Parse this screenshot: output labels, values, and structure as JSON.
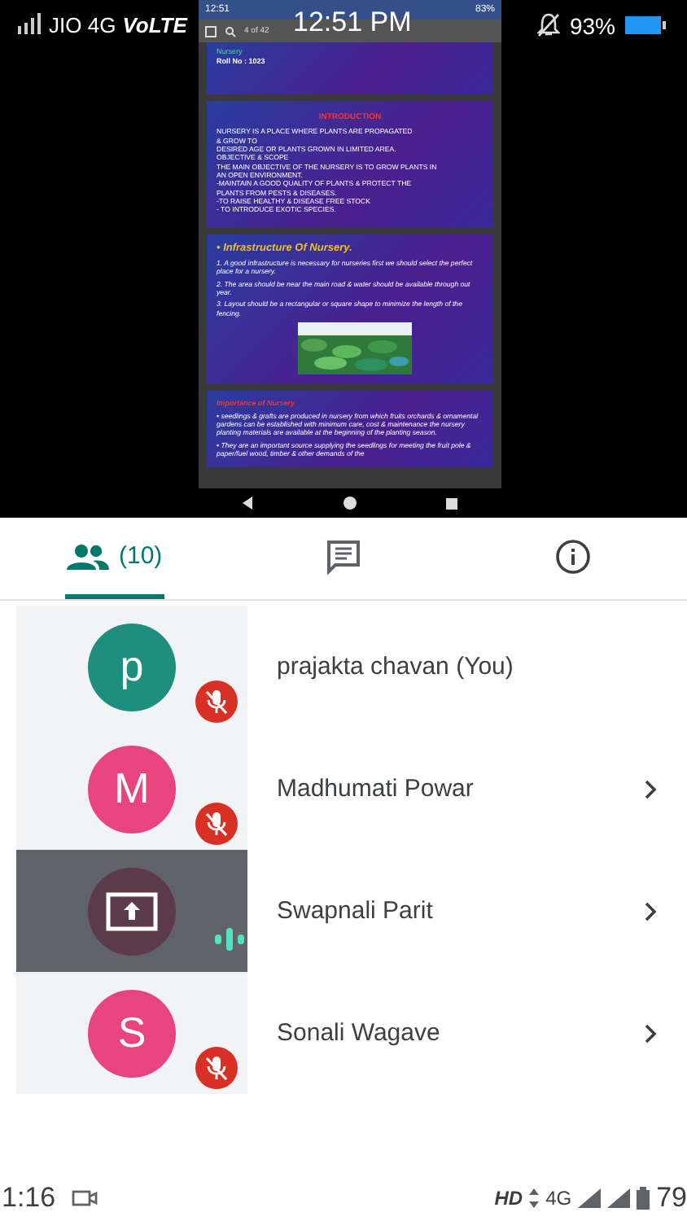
{
  "status_bar": {
    "carrier": "JIO 4G",
    "volte": "VoLTE",
    "battery": "93%"
  },
  "overlay_time": "12:51 PM",
  "shared_screen": {
    "status_time": "12:51",
    "status_battery": "83%",
    "page_counter": "4 of 42",
    "slides": [
      {
        "kind": "title",
        "lines": [
          "Nursery",
          "Roll No : 1023"
        ]
      },
      {
        "kind": "text",
        "heading": "INTRODUCTION",
        "lines": [
          "NURSERY IS A PLACE WHERE PLANTS ARE PROPAGATED",
          "& GROW TO",
          "DESIRED AGE OR PLANTS GROWN IN LIMITED AREA.",
          "OBJECTIVE & SCOPE",
          "THE MAIN OBJECTIVE OF THE NURSERY IS TO GROW PLANTS IN",
          "AN OPEN ENVIRONMENT.",
          "-MAINTAIN A GOOD QUALITY OF PLANTS & PROTECT THE",
          "PLANTS FROM PESTS & DISEASES.",
          "-TO RAISE HEALTHY & DISEASE FREE STOCK",
          "- TO INTRODUCE EXOTIC SPECIES."
        ]
      },
      {
        "kind": "list",
        "heading": "• Infrastructure Of Nursery.",
        "items": [
          "1. A good infrastructure is necessary for nurseries first we should select the perfect place for a nursery.",
          "2. The area should be near the main road & water should be available through out year.",
          "3. Layout should be a rectangular or square shape to minimize the length of the fencing."
        ],
        "image": {
          "kind": "picture"
        }
      },
      {
        "kind": "list",
        "heading": "Importance of Nursery",
        "items": [
          "• seedlings & grafts are produced in nursery from which fruits orchards & ornamental gardens can be established with minimum care, cost & maintenance the nursery planting materials are available at the beginning of the planting season.",
          "• They are an important source supplying the seedlings for meeting the fruit pole & paper/fuel wood, timber & other demands of the"
        ]
      }
    ]
  },
  "tabs": [
    {
      "kind": "people",
      "label": "(10)",
      "selected": true
    },
    {
      "kind": "chat",
      "selected": false
    },
    {
      "kind": "info",
      "selected": false
    }
  ],
  "participants": [
    {
      "kind": "avatar",
      "initial": "p",
      "color": "#1e8e7e",
      "name": "prajakta chavan (You)",
      "muted": true,
      "speaking": false,
      "expandable": false,
      "highlighted": false
    },
    {
      "kind": "avatar",
      "initial": "M",
      "color": "#e8457f",
      "name": "Madhumati Powar",
      "muted": true,
      "speaking": false,
      "expandable": true,
      "highlighted": false
    },
    {
      "kind": "screen-share",
      "color": "#5b3a4a",
      "name": "Swapnali Parit",
      "muted": false,
      "speaking": true,
      "expandable": true,
      "highlighted": true
    },
    {
      "kind": "avatar",
      "initial": "S",
      "color": "#e8457f",
      "name": "Sonali Wagave",
      "muted": true,
      "speaking": false,
      "expandable": true,
      "highlighted": false
    }
  ],
  "system_bar": {
    "time": "1:16",
    "hd": "HD",
    "network": "4G",
    "battery": "79"
  }
}
